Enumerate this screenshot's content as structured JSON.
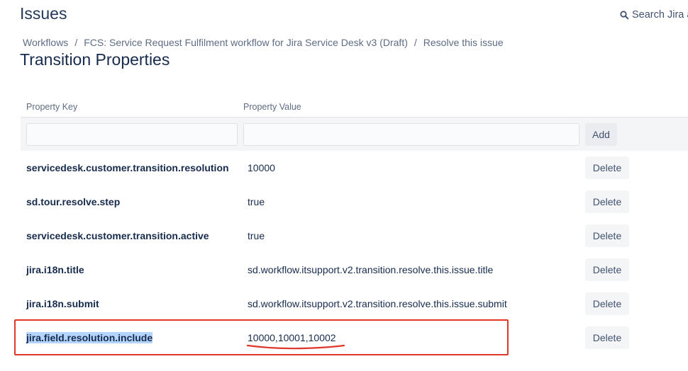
{
  "header": {
    "title": "Issues",
    "search_label": "Search Jira a"
  },
  "breadcrumb": {
    "items": [
      "Workflows",
      "FCS: Service Request Fulfilment workflow for Jira Service Desk v3 (Draft)",
      "Resolve this issue"
    ],
    "separator": "/"
  },
  "page": {
    "title": "Transition Properties"
  },
  "table": {
    "columns": [
      "Property Key",
      "Property Value"
    ],
    "add_button": "Add",
    "delete_label": "Delete",
    "key_placeholder": "",
    "value_placeholder": "",
    "rows": [
      {
        "key": "servicedesk.customer.transition.resolution",
        "value": "10000"
      },
      {
        "key": "sd.tour.resolve.step",
        "value": "true"
      },
      {
        "key": "servicedesk.customer.transition.active",
        "value": "true"
      },
      {
        "key": "jira.i18n.title",
        "value": "sd.workflow.itsupport.v2.transition.resolve.this.issue.title"
      },
      {
        "key": "jira.i18n.submit",
        "value": "sd.workflow.itsupport.v2.transition.resolve.this.issue.submit"
      },
      {
        "key": "jira.field.resolution.include",
        "value": "10000,10001,10002"
      }
    ]
  },
  "colors": {
    "annotation": "#e0362b",
    "selection": "#b3d4fc"
  },
  "icons": {
    "search": "search-icon"
  }
}
